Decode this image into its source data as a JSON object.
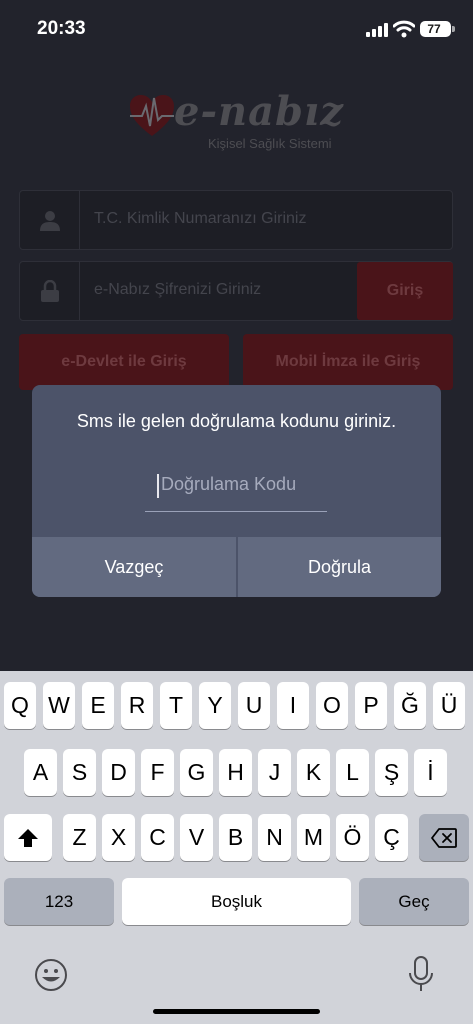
{
  "status_bar": {
    "time": "20:33",
    "battery": "77"
  },
  "logo": {
    "text": "e-nabız",
    "subtitle": "Kişisel Sağlık Sistemi"
  },
  "login": {
    "tc_placeholder": "T.C. Kimlik Numaranızı Giriniz",
    "password_placeholder": "e-Nabız Şifrenizi Giriniz",
    "giris_label": "Giriş",
    "edevlet_label": "e-Devlet ile Giriş",
    "mobil_imza_label": "Mobil İmza ile Giriş"
  },
  "alert": {
    "message": "Sms ile gelen doğrulama kodunu giriniz.",
    "input_placeholder": "Doğrulama Kodu",
    "cancel_label": "Vazgeç",
    "confirm_label": "Doğrula"
  },
  "keyboard": {
    "row1": [
      "Q",
      "W",
      "E",
      "R",
      "T",
      "Y",
      "U",
      "I",
      "O",
      "P",
      "Ğ",
      "Ü"
    ],
    "row2": [
      "A",
      "S",
      "D",
      "F",
      "G",
      "H",
      "J",
      "K",
      "L",
      "Ş",
      "İ"
    ],
    "row3": [
      "Z",
      "X",
      "C",
      "V",
      "B",
      "N",
      "M",
      "Ö",
      "Ç"
    ],
    "numbers_label": "123",
    "space_label": "Boşluk",
    "return_label": "Geç"
  },
  "colors": {
    "dialog": "#4c5369",
    "brand_red": "#4a1419",
    "keyboard_bg": "#d1d3d9"
  }
}
